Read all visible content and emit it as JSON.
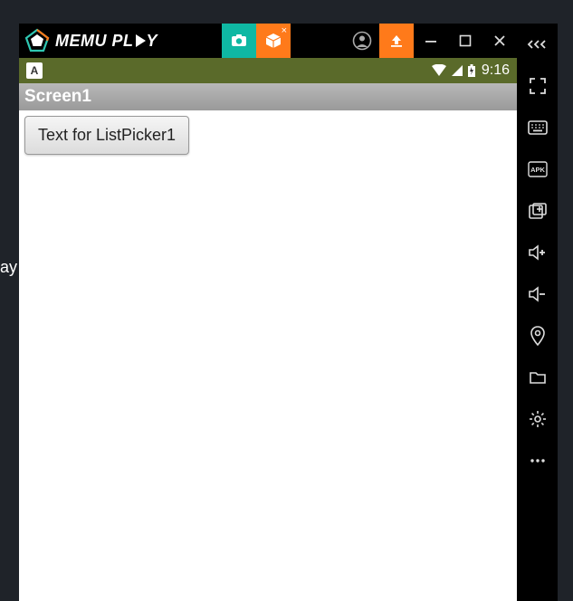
{
  "background": {
    "partial_text": "ay"
  },
  "titlebar": {
    "brand_left": "MEMU PL",
    "brand_right": "Y"
  },
  "statusbar": {
    "app_glyph": "A",
    "time": "9:16"
  },
  "screen": {
    "title": "Screen1"
  },
  "content": {
    "list_picker_label": "Text for ListPicker1"
  },
  "icons": {
    "camera": "camera-icon",
    "cube": "cube-icon",
    "profile": "profile-icon",
    "upload": "upload-icon",
    "minimize": "minimize-icon",
    "maximize": "maximize-icon",
    "close": "close-icon",
    "collapse": "collapse-chevrons-icon",
    "fullscreen": "fullscreen-icon",
    "keyboard": "keyboard-icon",
    "apk": "apk-icon",
    "add_frame": "add-frame-icon",
    "vol_up": "volume-up-icon",
    "vol_down": "volume-down-icon",
    "location": "location-icon",
    "folder": "folder-icon",
    "settings": "settings-icon",
    "more": "more-icon",
    "wifi": "wifi-icon",
    "signal": "signal-icon",
    "battery": "battery-icon"
  }
}
